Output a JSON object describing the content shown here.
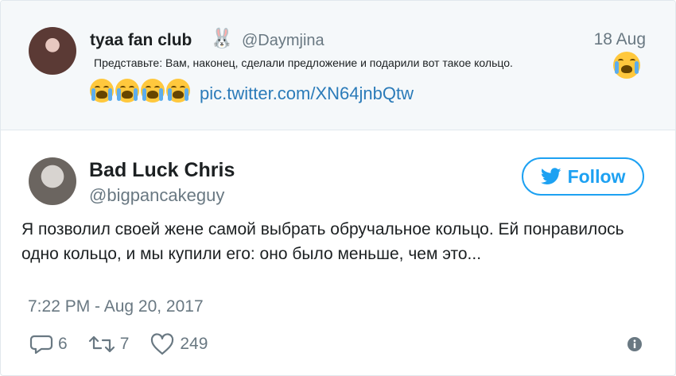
{
  "parent_tweet": {
    "author_name": "tyaa fan club",
    "author_emoji": "🐰",
    "handle": "@Daymjina",
    "date": "18 Aug",
    "text": "Представьте: Вам, наконец, сделали предложение и подарили вот такое кольцо.",
    "link": "pic.twitter.com/XN64jnbQtw"
  },
  "tweet": {
    "author_name": "Bad Luck Chris",
    "handle": "@bigpancakeguy",
    "follow_label": "Follow",
    "text": "Я позволил своей жене самой выбрать обручальное кольцо. Ей понравилось одно кольцо, и мы купили его: оно было меньше, чем это...",
    "timestamp": "7:22 PM - Aug 20, 2017",
    "replies": "6",
    "retweets": "7",
    "likes": "249"
  },
  "icons": {
    "reply": "speech-bubble-icon",
    "retweet": "retweet-icon",
    "like": "heart-icon",
    "info": "info-icon",
    "follow": "twitter-bird-icon",
    "emoji": "loudly-crying-face"
  },
  "colors": {
    "accent": "#1da1f2",
    "link": "#2b7bb9",
    "muted": "#697882",
    "parent_background": "#f5f8fa"
  }
}
